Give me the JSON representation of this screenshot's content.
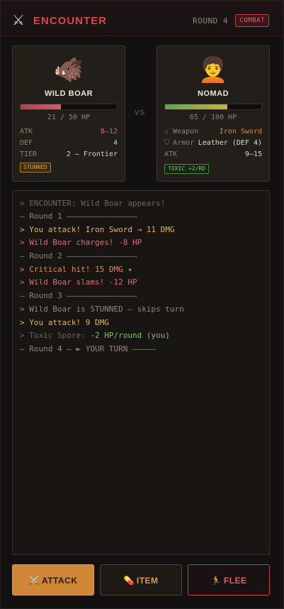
{
  "header": {
    "icon": "crossed-swords-icon",
    "title": "ENCOUNTER",
    "round_label": "ROUND 4",
    "mode_badge": "COMBAT"
  },
  "enemy": {
    "portrait_icon": "boar-icon",
    "name": "WILD BOAR",
    "hp_current": 21,
    "hp_max": 50,
    "hp_text": "21 / 50 HP",
    "stats": [
      {
        "label": "ATK",
        "value": "8–12"
      },
      {
        "label": "DEF",
        "value": "4"
      },
      {
        "label": "TIER",
        "value": "2 — Frontier"
      }
    ],
    "status": "STUNNED"
  },
  "versus_label": "VS",
  "player": {
    "portrait_icon": "person-icon",
    "name": "NOMAD",
    "hp_current": 65,
    "hp_max": 100,
    "hp_text": "65 / 100 HP",
    "weapon_label": "Weapon",
    "weapon_value": "Iron Sword",
    "armor_label": "Armor",
    "armor_value": "Leather (DEF 4)",
    "atk_label": "ATK",
    "atk_value": "9–15",
    "status": "TOXIC +2/RD"
  },
  "log": [
    {
      "type": "sys",
      "text": "> ENCOUNTER: Wild Boar appears!"
    },
    {
      "type": "round",
      "text": "— Round 1 ———————————————"
    },
    {
      "type": "you",
      "text": "> You attack! Iron Sword → 11 DMG"
    },
    {
      "type": "enemy",
      "text": "> Wild Boar charges! -8 HP"
    },
    {
      "type": "round",
      "text": "— Round 2 ———————————————"
    },
    {
      "type": "crit",
      "text": "> Critical hit! 15 DMG ✦"
    },
    {
      "type": "enemy",
      "text": "> Wild Boar slams! -12 HP"
    },
    {
      "type": "round",
      "text": "— Round 3 ———————————————"
    },
    {
      "type": "neutral",
      "text": "> Wild Boar is STUNNED — skips turn"
    },
    {
      "type": "you",
      "text": "> You attack! 9 DMG"
    },
    {
      "type": "toxic",
      "prefix": "> Toxic Spore: ",
      "text": "-2 HP/round (you)"
    },
    {
      "type": "turn",
      "text": "— Round 4 — ► YOUR TURN —————"
    }
  ],
  "actions": {
    "attack_icon": "⚔️",
    "attack_label": "ATTACK",
    "item_icon": "💊",
    "item_label": "ITEM",
    "flee_icon": "🏃",
    "flee_label": "FLEE"
  }
}
